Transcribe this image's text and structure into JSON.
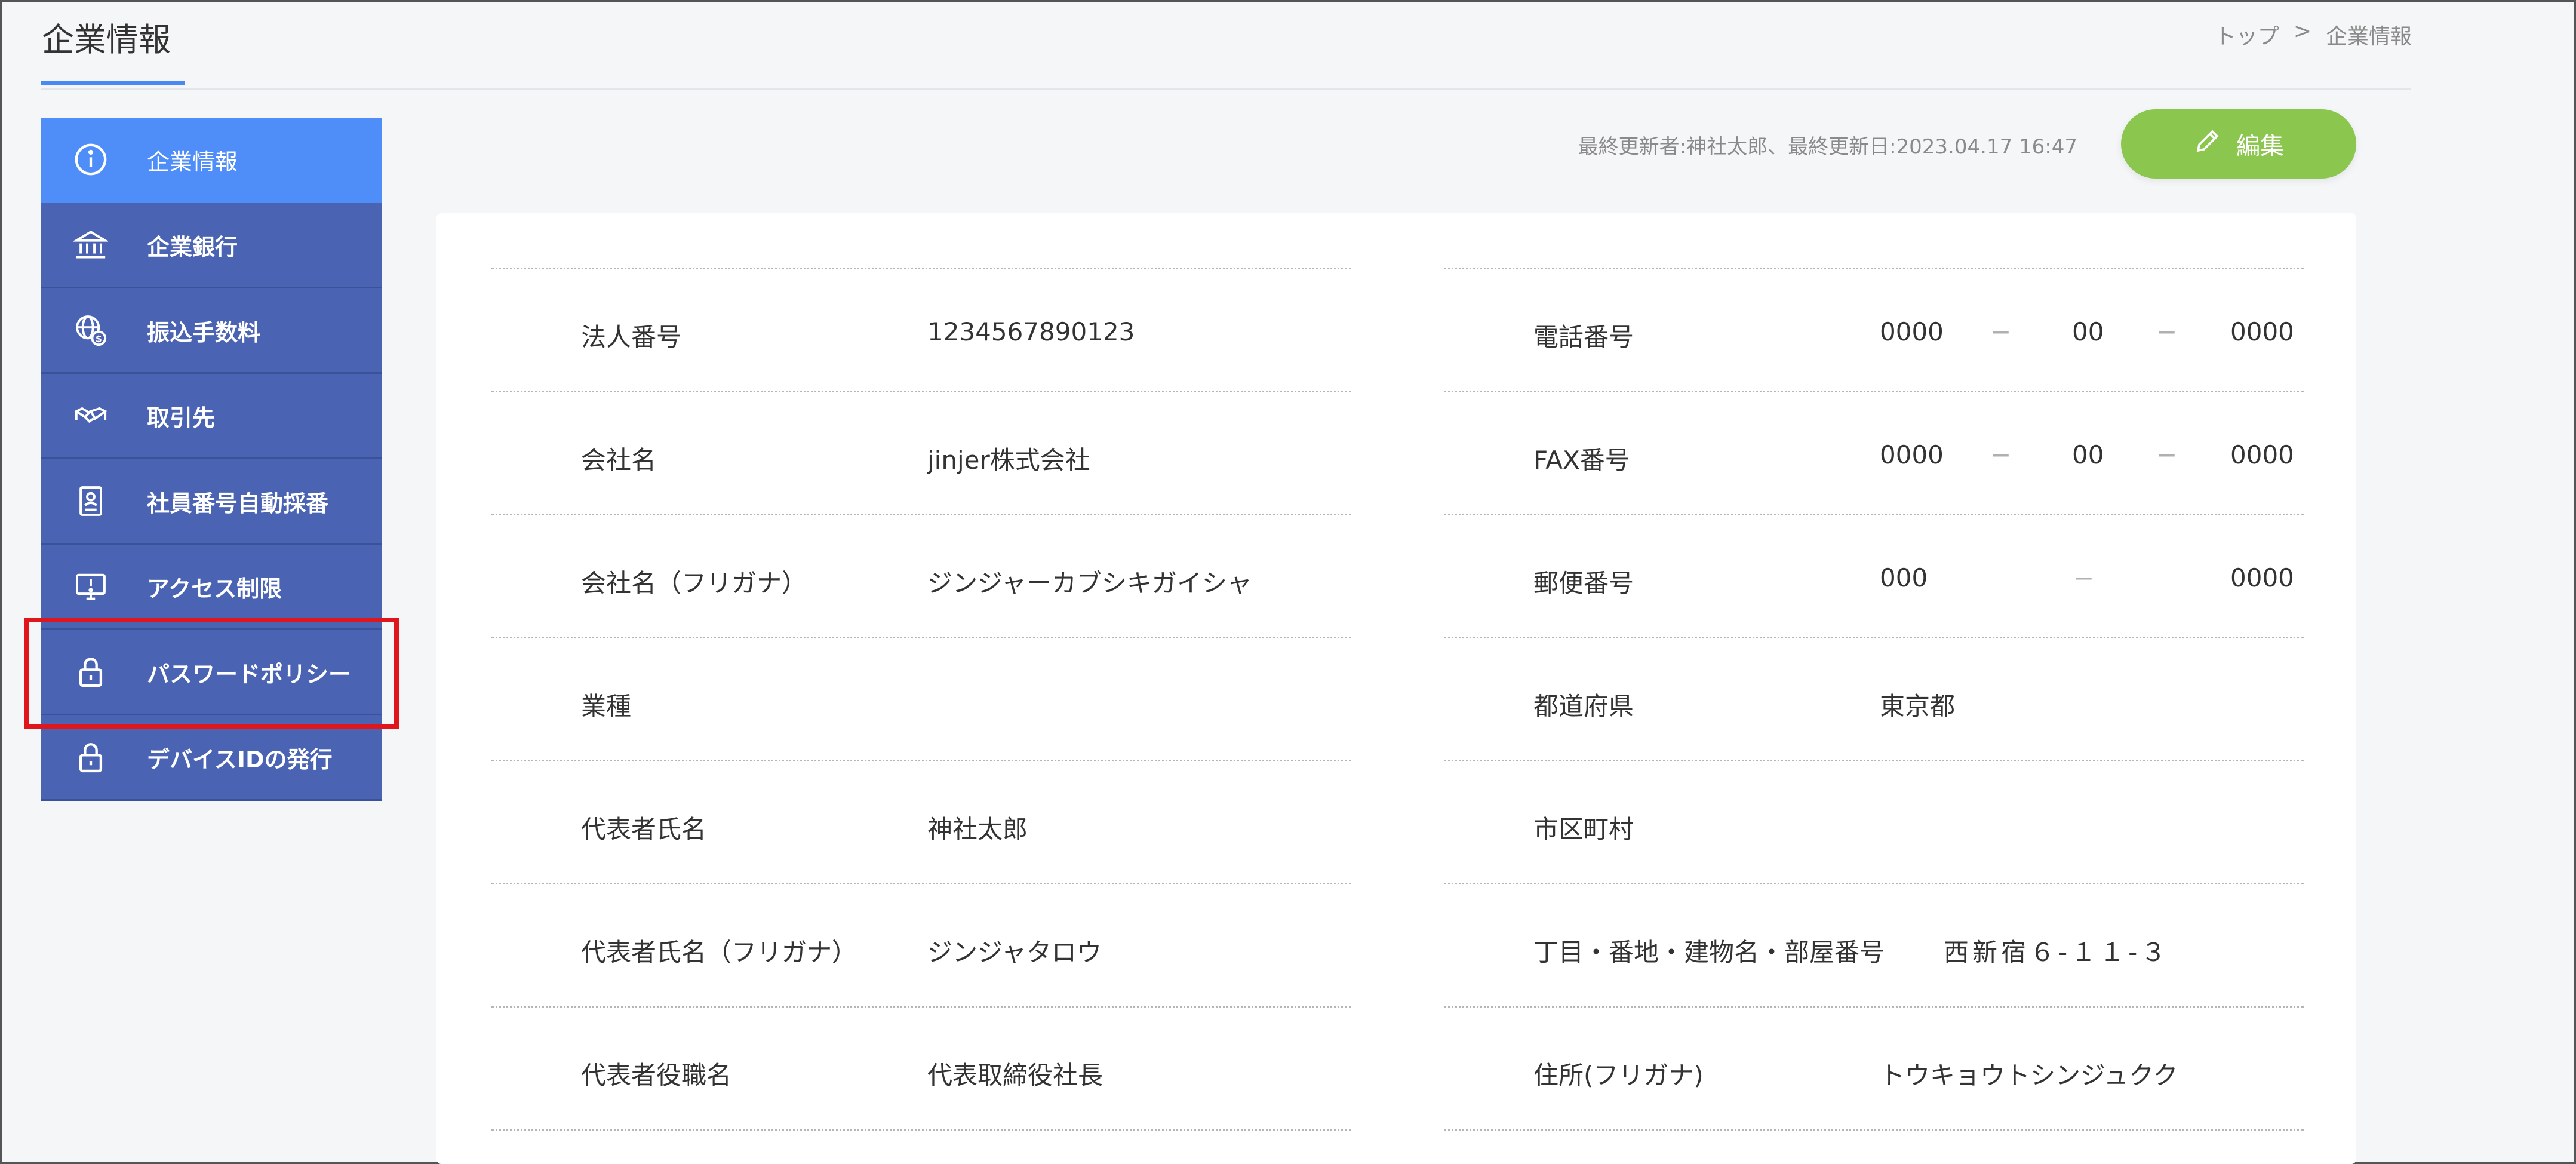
{
  "header": {
    "title": "企業情報",
    "breadcrumb": [
      "トップ",
      ">",
      "企業情報"
    ]
  },
  "sidebar": {
    "items": [
      {
        "label": "企業情報",
        "icon": "info-icon",
        "active": true
      },
      {
        "label": "企業銀行",
        "icon": "bank-icon"
      },
      {
        "label": "振込手数料",
        "icon": "globe-money-icon"
      },
      {
        "label": "取引先",
        "icon": "handshake-icon"
      },
      {
        "label": "社員番号自動採番",
        "icon": "id-card-icon"
      },
      {
        "label": "アクセス制限",
        "icon": "monitor-alert-icon"
      },
      {
        "label": "パスワードポリシー",
        "icon": "lock-icon"
      },
      {
        "label": "デバイスIDの発行",
        "icon": "lock-icon"
      }
    ]
  },
  "update_info": "最終更新者:神社太郎、最終更新日:2023.04.17 16:47",
  "edit_button": {
    "label": "編集",
    "icon": "pencil-icon"
  },
  "left_fields": [
    {
      "label": "法人番号",
      "value": "1234567890123"
    },
    {
      "label": "会社名",
      "value": "jinjer株式会社"
    },
    {
      "label": "会社名（フリガナ）",
      "value": "ジンジャーカブシキガイシャ"
    },
    {
      "label": "業種",
      "value": ""
    },
    {
      "label": "代表者氏名",
      "value": "神社太郎"
    },
    {
      "label": "代表者氏名（フリガナ）",
      "value": "ジンジャタロウ"
    },
    {
      "label": "代表者役職名",
      "value": "代表取締役社長"
    }
  ],
  "right_fields": {
    "phone": {
      "label": "電話番号",
      "parts": [
        "0000",
        "00",
        "0000"
      ],
      "sep": "−"
    },
    "fax": {
      "label": "FAX番号",
      "parts": [
        "0000",
        "00",
        "0000"
      ],
      "sep": "−"
    },
    "postal": {
      "label": "郵便番号",
      "parts": [
        "000",
        "0000"
      ],
      "sep": "−"
    },
    "prefecture": {
      "label": "都道府県",
      "value": "東京都"
    },
    "city": {
      "label": "市区町村",
      "value": ""
    },
    "address": {
      "label": "丁目・番地・建物名・部屋番号",
      "value": "西新宿６-１１-３"
    },
    "address_kana": {
      "label": "住所(フリガナ)",
      "value": "トウキョウトシンジュクク"
    }
  },
  "colors": {
    "accent": "#4f8df8",
    "sidebar": "#4a63b3",
    "edit_button": "#8bc64f",
    "highlight": "#e0161d"
  }
}
